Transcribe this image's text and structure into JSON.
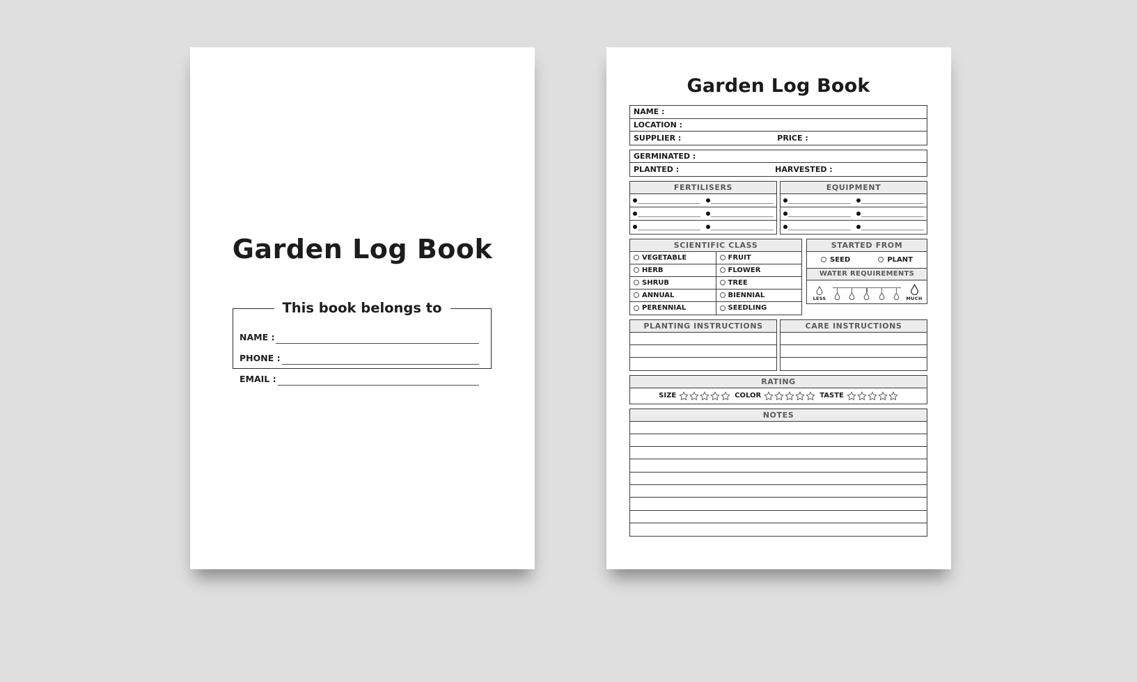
{
  "theme": {
    "background": "#dfdfdf",
    "paper": "#ffffff",
    "ink": "#1b1b1b",
    "header_fill": "#ececec",
    "header_text": "#5a5a5a",
    "rule": "#3b3b3b"
  },
  "cover": {
    "title": "Garden Log Book",
    "belongs_heading": "This book belongs to",
    "fields": [
      {
        "label": "NAME :",
        "value": ""
      },
      {
        "label": "PHONE :",
        "value": ""
      },
      {
        "label": "EMAIL :",
        "value": ""
      }
    ]
  },
  "interior": {
    "title": "Garden Log Book",
    "info_block": [
      {
        "left": "NAME :",
        "right": ""
      },
      {
        "left": "LOCATION :",
        "right": ""
      },
      {
        "left": "SUPPLIER :",
        "right": "PRICE :"
      }
    ],
    "date_block": [
      {
        "left": "GERMINATED :",
        "right": ""
      },
      {
        "left": "PLANTED :",
        "right": "HARVESTED :"
      }
    ],
    "fertilisers": {
      "title": "FERTILISERS",
      "rows": 3,
      "cols": 2
    },
    "equipment": {
      "title": "EQUIPMENT",
      "rows": 3,
      "cols": 2
    },
    "scientific_class": {
      "title": "SCIENTIFIC CLASS",
      "options": [
        [
          "VEGETABLE",
          "FRUIT"
        ],
        [
          "HERB",
          "FLOWER"
        ],
        [
          "SHRUB",
          "TREE"
        ],
        [
          "ANNUAL",
          "BIENNIAL"
        ],
        [
          "PERENNIAL",
          "SEEDLING"
        ]
      ]
    },
    "started_from": {
      "title": "STARTED FROM",
      "options": [
        "SEED",
        "PLANT"
      ]
    },
    "water_requirements": {
      "title": "WATER REQUIREMENTS",
      "min_label": "LESS",
      "max_label": "MUCH",
      "steps": 5
    },
    "planting_instructions": {
      "title": "PLANTING INSTRUCTIONS",
      "lines": 3
    },
    "care_instructions": {
      "title": "CARE INSTRUCTIONS",
      "lines": 3
    },
    "rating": {
      "title": "RATING",
      "groups": [
        {
          "label": "SIZE",
          "stars": 5,
          "filled": 0
        },
        {
          "label": "COLOR",
          "stars": 5,
          "filled": 0
        },
        {
          "label": "TASTE",
          "stars": 5,
          "filled": 0
        }
      ]
    },
    "notes": {
      "title": "NOTES",
      "lines": 9
    }
  }
}
